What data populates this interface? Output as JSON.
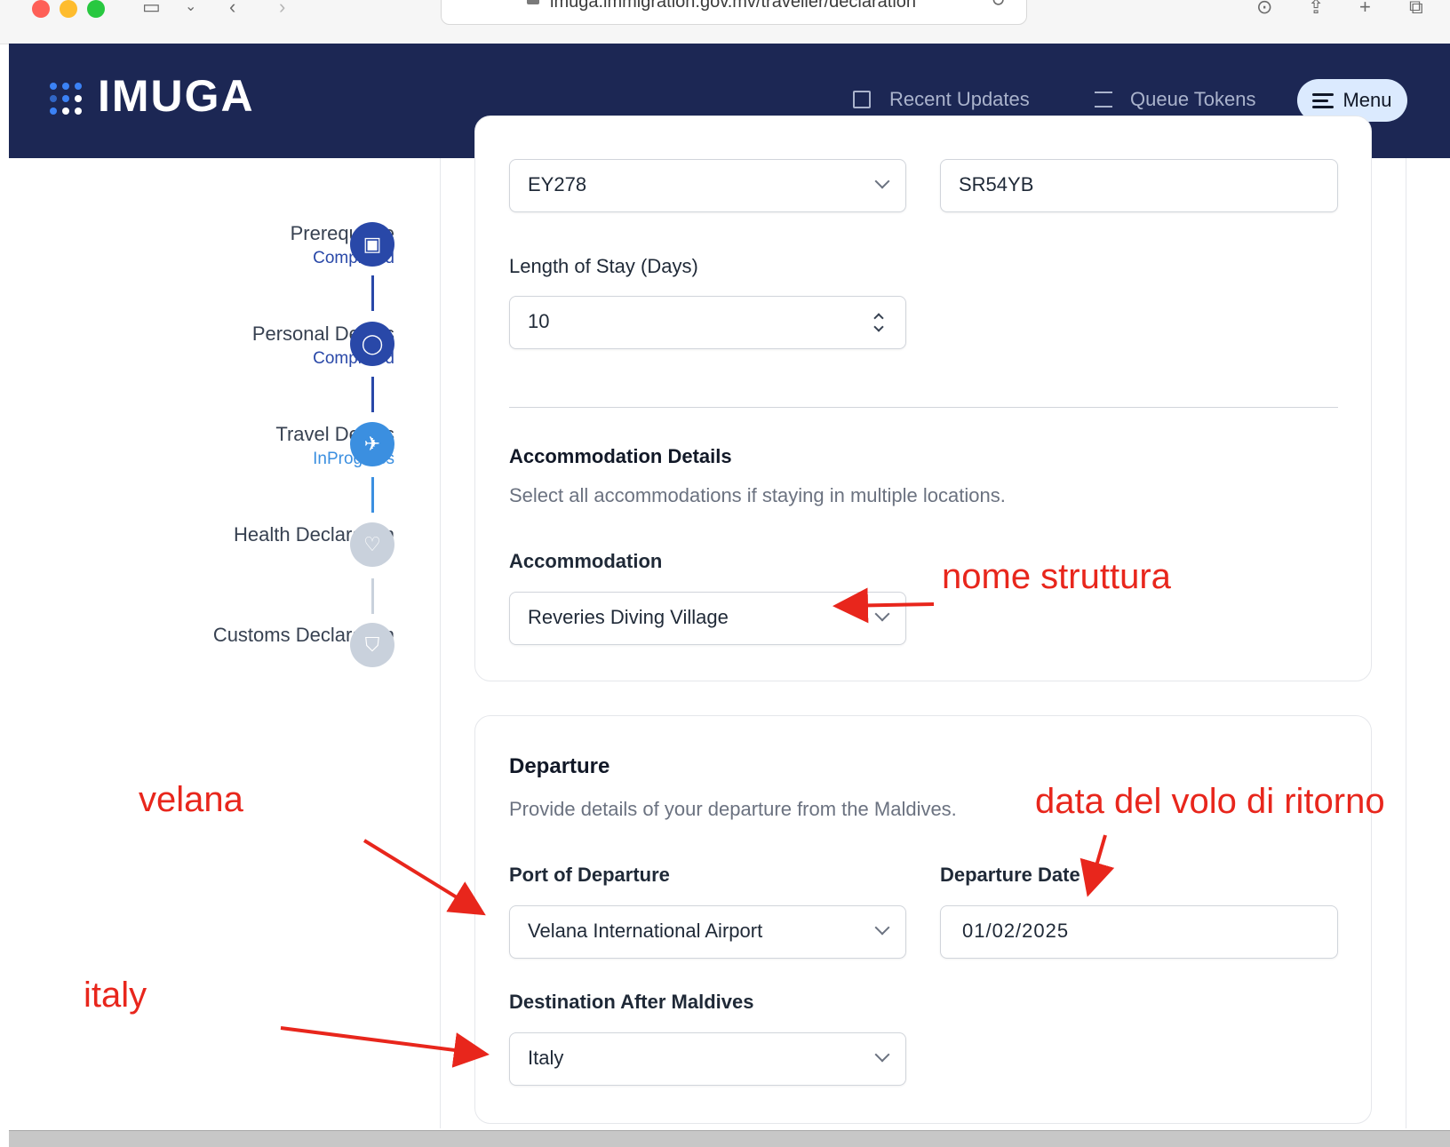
{
  "browser": {
    "url": "imuga.immigration.gov.mv/traveller/declaration"
  },
  "header": {
    "logo": "IMUGA",
    "recent_updates": "Recent Updates",
    "queue_tokens": "Queue Tokens",
    "menu": "Menu"
  },
  "steps": [
    {
      "title": "Prerequisite",
      "status": "Completed",
      "icon": "passport-icon"
    },
    {
      "title": "Personal Details",
      "status": "Completed",
      "icon": "user-icon"
    },
    {
      "title": "Travel Details",
      "status": "InProgress",
      "icon": "plane-icon"
    },
    {
      "title": "Health Declaration",
      "status": "",
      "icon": "heart-icon"
    },
    {
      "title": "Customs Declaration",
      "status": "",
      "icon": "shield-icon"
    }
  ],
  "arrival": {
    "flight_number": "EY278",
    "seat": "SR54YB",
    "length_of_stay_label": "Length of Stay (Days)",
    "length_of_stay": "10"
  },
  "accommodation": {
    "title": "Accommodation Details",
    "description": "Select all accommodations if staying in multiple locations.",
    "label": "Accommodation",
    "value": "Reveries Diving Village"
  },
  "departure": {
    "title": "Departure",
    "description": "Provide details of your departure from the Maldives.",
    "port_label": "Port of Departure",
    "port_value": "Velana International Airport",
    "date_label": "Departure Date",
    "date_value": "01/02/2025",
    "destination_label": "Destination After Maldives",
    "destination_value": "Italy"
  },
  "annotations": {
    "accommodation_note": "nome struttura",
    "port_note": "velana",
    "date_note": "data del volo di ritorno",
    "destination_note": "italy"
  },
  "colors": {
    "header_bg": "#1c2754",
    "step_done": "#2948a8",
    "step_active": "#3b8fe0",
    "step_pending": "#c9d1dc",
    "annotation": "#e8261c"
  }
}
